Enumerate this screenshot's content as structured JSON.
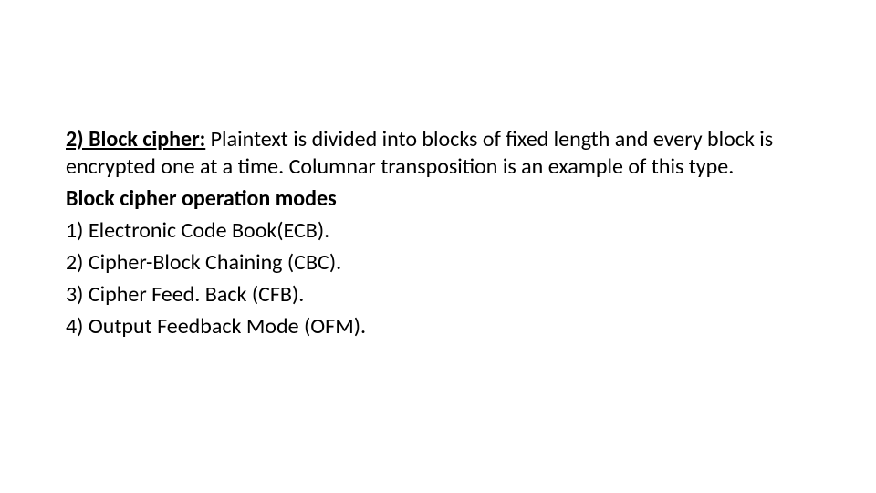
{
  "slide": {
    "p1_label": "2) Block cipher:",
    "p1_rest": " Plaintext is divided into blocks of fixed length and every block is encrypted one at a time. Columnar transposition is an example of this type.",
    "p2": "Block cipher operation modes",
    "items": [
      "1) Electronic Code Book(ECB).",
      "2) Cipher-Block Chaining (CBC).",
      "3) Cipher Feed. Back (CFB).",
      "4) Output Feedback Mode (OFM)."
    ]
  }
}
